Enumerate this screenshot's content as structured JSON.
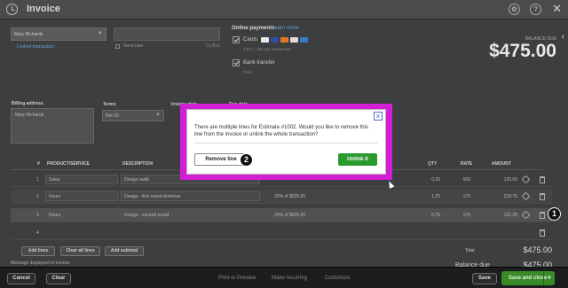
{
  "header": {
    "title": "Invoice",
    "help": "?",
    "close": "✕"
  },
  "customer": {
    "name": "Mary Richards",
    "link": "1 linked transaction",
    "cc_label": "Send later",
    "cc_right": "Cc/Bcc"
  },
  "online_payments": {
    "title": "Online payments",
    "learn_more": "Learn more",
    "cards_label": "Cards",
    "cards_sub": "2.9% + 25¢ per transaction",
    "bank_label": "Bank transfer",
    "bank_sub": "Free"
  },
  "balance": {
    "label": "BALANCE DUE",
    "amount": "$475.00"
  },
  "form": {
    "billing_label": "Billing address",
    "billing_value": "Mary Richards",
    "terms_label": "Terms",
    "terms_value": "Net 30",
    "invoice_date_label": "Invoice date",
    "due_date_label": "Due date"
  },
  "table": {
    "headers": {
      "num": "#",
      "product": "PRODUCT/SERVICE",
      "description": "DESCRIPTION",
      "qty": "QTY",
      "rate": "RATE",
      "amount": "AMOUNT"
    },
    "rows": [
      {
        "num": "1",
        "product": "Sales",
        "description": "Design audit",
        "desc2": "",
        "qty": "0.25",
        "rate": "500",
        "amount": "125.00"
      },
      {
        "num": "2",
        "product": "Hours",
        "description": "Design - first round sketches",
        "desc2": "25% of $525.00",
        "qty": "1.25",
        "rate": "175",
        "amount": "218.75"
      },
      {
        "num": "3",
        "product": "Hours",
        "description": "Design - second round",
        "desc2": "25% of $525.00",
        "qty": "0.75",
        "rate": "175",
        "amount": "131.25"
      },
      {
        "num": "4",
        "product": "",
        "description": "",
        "desc2": "",
        "qty": "",
        "rate": "",
        "amount": ""
      }
    ]
  },
  "buttons": {
    "add_lines": "Add lines",
    "clear_all": "Clear all lines",
    "add_subtotal": "Add subtotal"
  },
  "totals": {
    "total_label": "Total",
    "total_amount": "$475.00",
    "balance_due_label": "Balance due",
    "balance_due_amount": "$475.00",
    "message_label": "Message displayed on invoice"
  },
  "footer": {
    "cancel": "Cancel",
    "clear": "Clear",
    "print": "Print or Preview",
    "recurring": "Make recurring",
    "customize": "Customize",
    "save": "Save",
    "save_close": "Save and close"
  },
  "dialog": {
    "message": "There are multiple lines for Estimate #1002. Would you like to remove this line from the invoice or unlink the whole transaction?",
    "remove_label": "Remove line",
    "unlink_label": "Unlink it"
  },
  "callouts": {
    "one": "1",
    "two": "2"
  },
  "colors": {
    "highlight": "#d21fd6",
    "primary_green": "#2a9a2e"
  }
}
